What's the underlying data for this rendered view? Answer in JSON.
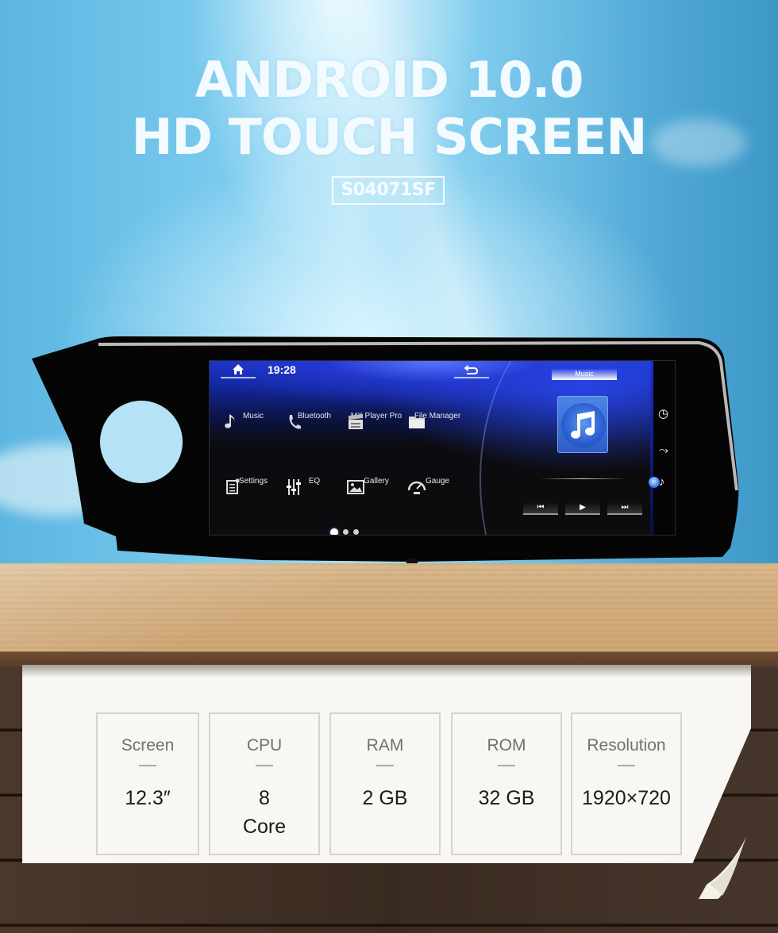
{
  "headline": {
    "line1": "ANDROID 10.0",
    "line2": "HD TOUCH SCREEN",
    "model": "S04071SF"
  },
  "screen": {
    "time": "19:28",
    "icons": {
      "home": "home-icon",
      "back": "back-arrow-icon"
    },
    "apps": [
      {
        "label": "Music",
        "icon": "music-note-icon"
      },
      {
        "label": "Bluetooth",
        "icon": "phone-icon"
      },
      {
        "label": "MX Player Pro",
        "icon": "clapperboard-icon"
      },
      {
        "label": "File Manager",
        "icon": "folder-icon"
      },
      {
        "label": "Settings",
        "icon": "settings-doc-icon"
      },
      {
        "label": "EQ",
        "icon": "equalizer-icon"
      },
      {
        "label": "Gallery",
        "icon": "image-icon"
      },
      {
        "label": "Gauge",
        "icon": "speedometer-icon"
      }
    ],
    "page_indicator": {
      "pages": 3,
      "active": 1
    },
    "music_widget": {
      "tab_label": "Music",
      "controls": [
        {
          "name": "previous",
          "glyph": "⏮"
        },
        {
          "name": "play",
          "glyph": "▶"
        },
        {
          "name": "next",
          "glyph": "⏭"
        }
      ]
    },
    "side_icons": [
      {
        "name": "clock-icon",
        "glyph": "◷"
      },
      {
        "name": "navigation-icon",
        "glyph": "⤳"
      },
      {
        "name": "music-note-icon",
        "glyph": "♪"
      }
    ]
  },
  "specs": [
    {
      "label": "Screen",
      "value": "12.3″"
    },
    {
      "label": "CPU",
      "value": "8",
      "value2": "Core"
    },
    {
      "label": "RAM",
      "value": "2 GB"
    },
    {
      "label": "ROM",
      "value": "32 GB"
    },
    {
      "label": "Resolution",
      "value": "1920×720"
    }
  ],
  "colors": {
    "sky": "#7ccbef",
    "screen_accent": "#1c33c8",
    "paper": "#f8f7f3",
    "table": "#d3ae80"
  }
}
